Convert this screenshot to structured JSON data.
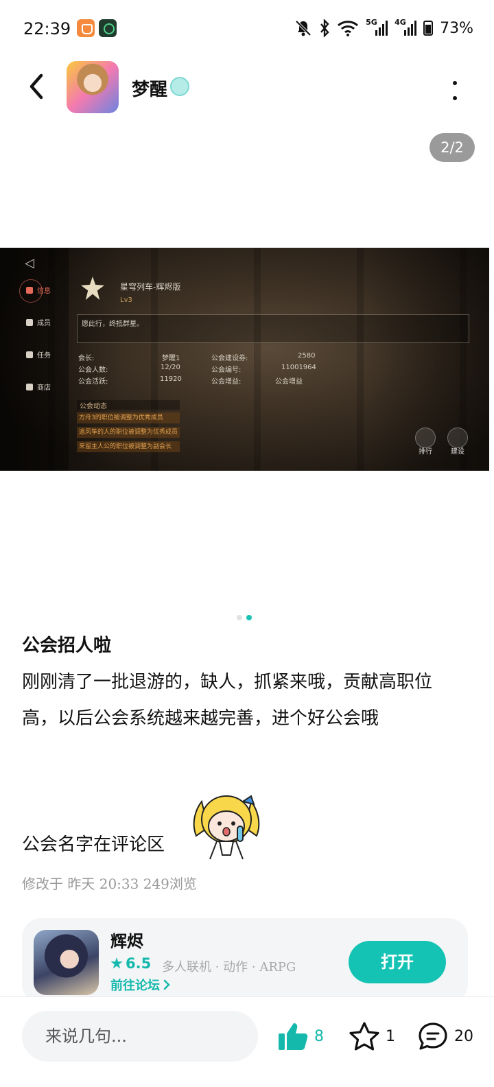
{
  "status_bar": {
    "time": "22:39",
    "signal_1_label": "5G",
    "signal_2_label": "4G",
    "battery": "73%",
    "icons": [
      "app-notification-icon",
      "game-app-icon",
      "mute-icon",
      "bluetooth-icon",
      "wifi-icon",
      "signal-icon",
      "signal-icon",
      "battery-icon"
    ]
  },
  "header": {
    "username": "梦醒",
    "icons": [
      "back-arrow-icon",
      "verified-badge-icon",
      "more-vertical-icon"
    ]
  },
  "gallery": {
    "counter": "2/2",
    "current_index": 2,
    "total": 2,
    "image": {
      "nav": [
        "信息",
        "成员",
        "任务",
        "商店"
      ],
      "guild_name": "星穹列车-辉烬版",
      "guild_level": "Lv3",
      "motto": "愿此行，终抵群星。",
      "stats": [
        {
          "label": "会长:",
          "value": "梦醒1"
        },
        {
          "label": "公会人数:",
          "value": "12/20"
        },
        {
          "label": "公会活跃:",
          "value": "11920"
        },
        {
          "label": "公会建设券:",
          "value": "2580"
        },
        {
          "label": "公会编号:",
          "value": "11001964"
        },
        {
          "label": "公会增益:",
          "value": "公会增益"
        }
      ],
      "news_title": "公会动态",
      "news": [
        "方舟3的职位被调整为优秀成员",
        "追风筝的人的职位被调整为优秀成员",
        "来留主人公的职位被调整为副会长"
      ],
      "buttons": [
        "排行",
        "建设"
      ]
    }
  },
  "post": {
    "title": "公会招人啦",
    "body": "刚刚清了一批退游的，缺人，抓紧来哦，贡献高职位高，以后公会系统越来越完善，进个好公会哦",
    "last_line": "公会名字在评论区",
    "meta": "修改于 昨天 20:33  249浏览"
  },
  "app_card": {
    "name": "辉烬",
    "rating": "6.5",
    "tags": "多人联机 · 动作 · ARPG",
    "forum_link": "前往论坛",
    "open_label": "打开"
  },
  "bottom_bar": {
    "comment_placeholder": "来说几句...",
    "likes": "8",
    "favorites": "1",
    "comments": "20"
  },
  "colors": {
    "accent": "#14C3B4",
    "text": "#111111",
    "muted": "#999999",
    "card_bg": "#F3F5F7",
    "counter_bg": "#9A9A9A"
  }
}
